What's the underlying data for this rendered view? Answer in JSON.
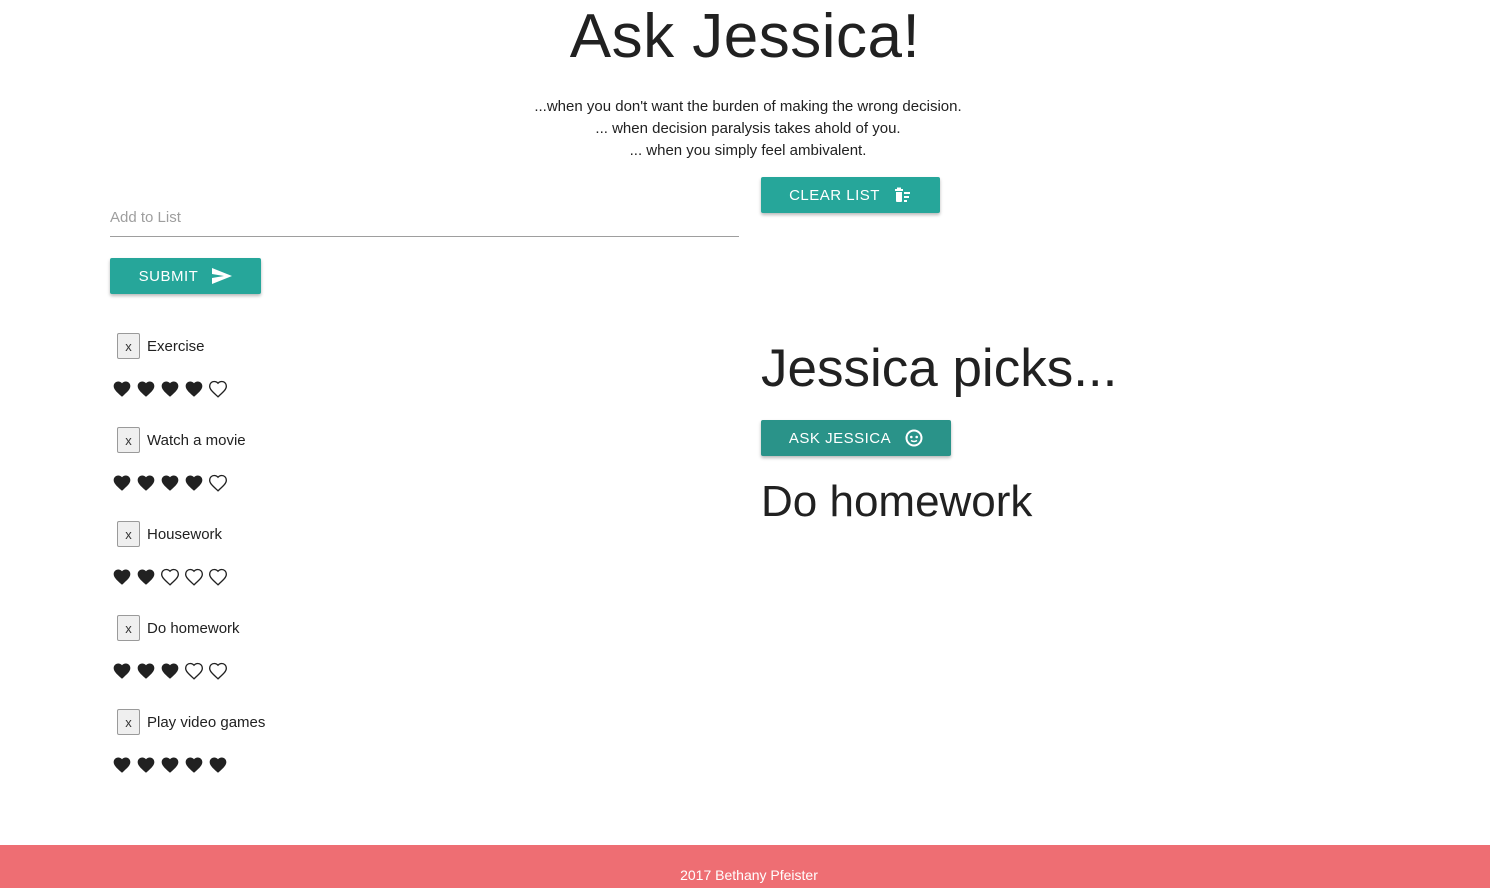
{
  "header": {
    "title": "Ask Jessica!",
    "taglines": [
      "...when you don't want the burden of making the wrong decision.",
      "... when decision paralysis takes ahold of you.",
      "... when you simply feel ambivalent."
    ]
  },
  "form": {
    "input_placeholder": "Add to List",
    "input_value": "",
    "submit_label": "SUBMIT",
    "submit_icon": "send-icon",
    "clear_label": "CLEAR LIST",
    "clear_icon": "delete-sweep-icon"
  },
  "list": {
    "remove_label": "x",
    "max_rating": 5,
    "items": [
      {
        "label": "Exercise",
        "rating": 4
      },
      {
        "label": "Watch a movie",
        "rating": 4
      },
      {
        "label": "Housework",
        "rating": 2
      },
      {
        "label": "Do homework",
        "rating": 3
      },
      {
        "label": "Play video games",
        "rating": 5
      }
    ]
  },
  "picker": {
    "heading": "Jessica picks...",
    "ask_label": "ASK JESSICA",
    "ask_icon": "face-icon",
    "result": "Do homework"
  },
  "footer": {
    "text": "2017 Bethany Pfeister"
  },
  "colors": {
    "accent": "#26a69a",
    "ask_button": "#2a9389",
    "footer": "#ee6e73"
  }
}
